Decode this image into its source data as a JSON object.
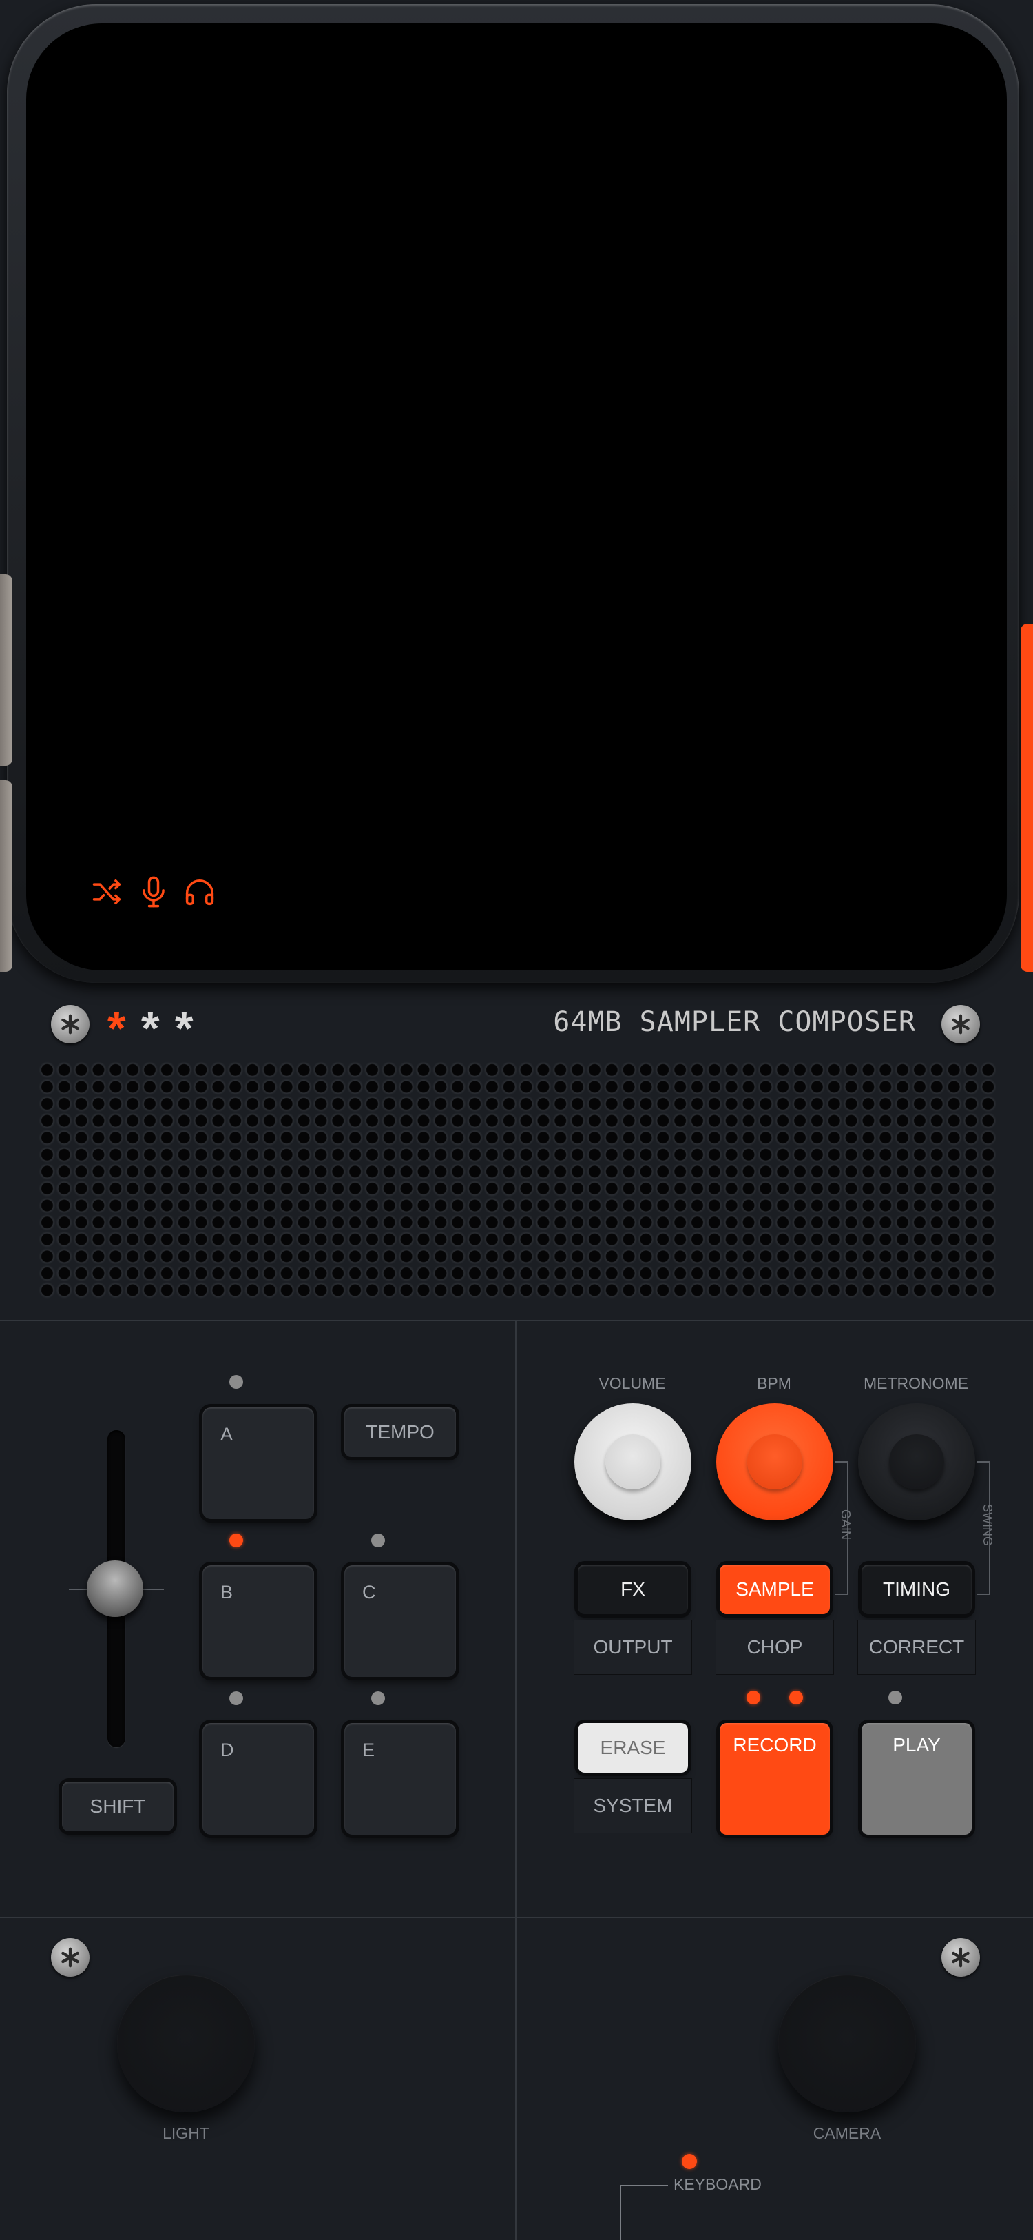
{
  "status_icons": [
    "shuffle-icon",
    "microphone-icon",
    "headphones-icon"
  ],
  "brand": {
    "text": "64MB SAMPLER COMPOSER",
    "stars": "***"
  },
  "pads": {
    "a": "A",
    "b": "B",
    "c": "C",
    "d": "D",
    "e": "E"
  },
  "buttons": {
    "tempo": "TEMPO",
    "shift": "SHIFT",
    "fx": "FX",
    "output": "OUTPUT",
    "sample": "SAMPLE",
    "chop": "CHOP",
    "timing": "TIMING",
    "correct": "CORRECT",
    "erase": "ERASE",
    "system": "SYSTEM",
    "record": "RECORD",
    "play": "PLAY"
  },
  "knobs": {
    "volume": "VOLUME",
    "bpm": "BPM",
    "metronome": "METRONOME",
    "gain": "GAIN",
    "swing": "SWING"
  },
  "dials": {
    "light": "LIGHT",
    "camera": "CAMERA"
  },
  "keyboard": "KEYBOARD",
  "colors": {
    "accent": "#ff4a14",
    "panel": "#1b1e23",
    "screen": "#000000"
  }
}
